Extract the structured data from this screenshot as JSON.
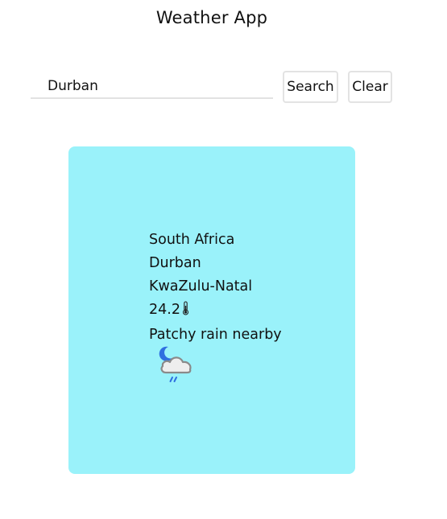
{
  "app": {
    "title": "Weather App"
  },
  "search": {
    "value": "Durban",
    "search_label": "Search",
    "clear_label": "Clear"
  },
  "weather": {
    "country": "South Africa",
    "city": "Durban",
    "region": "KwaZulu-Natal",
    "temperature": "24.2",
    "temperature_icon": "thermometer-icon",
    "condition": "Patchy rain nearby",
    "condition_icon": "moon-cloud-rain-icon"
  },
  "colors": {
    "card_background": "#9af2fa",
    "moon": "#2f6fe0",
    "rain": "#2f6fe0",
    "cloud_fill": "#eeeeee",
    "cloud_stroke": "#8a8a8a"
  }
}
